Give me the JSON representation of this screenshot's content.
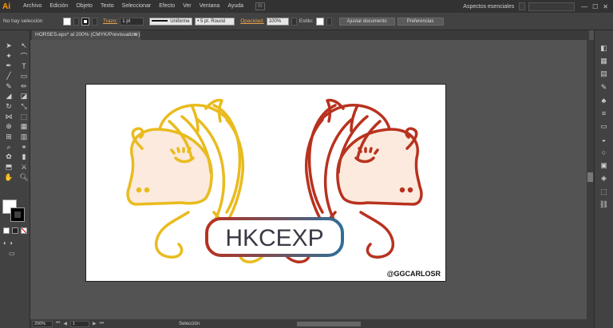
{
  "menubar": {
    "logo": "Ai",
    "items": [
      "Archivo",
      "Edición",
      "Objeto",
      "Texto",
      "Seleccionar",
      "Efecto",
      "Ver",
      "Ventana",
      "Ayuda"
    ],
    "bridge": "Br",
    "workspace": "Aspectos esenciales",
    "window_controls": [
      "—",
      "☐",
      "✕"
    ]
  },
  "controlbar": {
    "selection_status": "No hay selección",
    "stroke_label": "Trazo:",
    "stroke_weight": "1 pt",
    "stroke_profile": "Uniforme",
    "brush": "5 pt. Round",
    "opacity_label": "Opacidad:",
    "opacity_value": "100%",
    "style_label": "Estilo:",
    "doc_setup_button": "Ajustar documento",
    "prefs_button": "Preferencias"
  },
  "document": {
    "tab_title": "HORSES.eps* al 200% (CMYK/Previsualizar)",
    "close_glyph": "✕"
  },
  "artwork": {
    "logo_text": "HKCEXP",
    "handle": "@GGCARLOSR",
    "colors": {
      "gold": "#e9bb1e",
      "red": "#b8321f",
      "face": "#fbeadd",
      "blue": "#2f6e98",
      "text": "#3a3a46"
    }
  },
  "statusbar": {
    "zoom": "200%",
    "artboard_number": "1",
    "status_text": "Selección"
  },
  "colors": {
    "app_dark": "#323232",
    "panel": "#424242",
    "canvas": "#535353",
    "accent_link": "#e8a34c"
  }
}
